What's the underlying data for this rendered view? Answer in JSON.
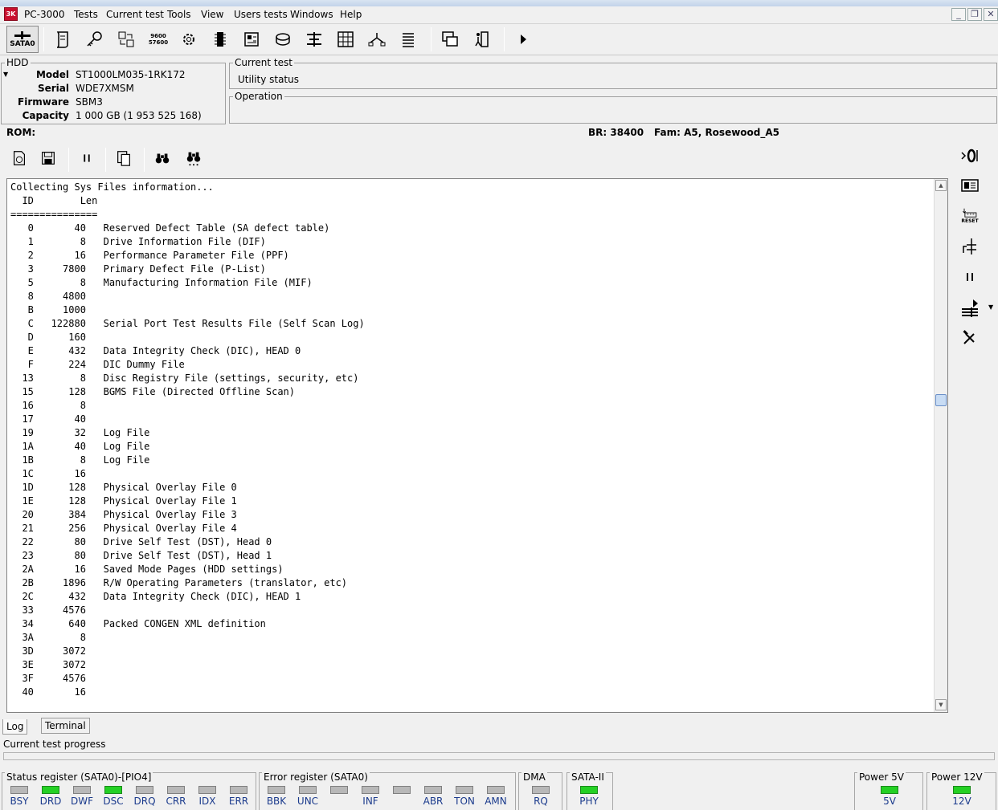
{
  "app": {
    "title": "PC-3000"
  },
  "menu": [
    "Tests",
    "Current test",
    "Tools",
    "View",
    "Users tests",
    "Windows",
    "Help"
  ],
  "toolbar": {
    "sata_label": "SATA0",
    "baud_top": "9600",
    "baud_bottom": "57600"
  },
  "hdd": {
    "legend": "HDD",
    "fields": [
      {
        "label": "Model",
        "value": "ST1000LM035-1RK172"
      },
      {
        "label": "Serial",
        "value": "WDE7XMSM"
      },
      {
        "label": "Firmware",
        "value": "SBM3"
      },
      {
        "label": "Capacity",
        "value": "1 000 GB (1 953 525 168)"
      }
    ]
  },
  "current_test": {
    "legend": "Current test",
    "value": "Utility status"
  },
  "operation": {
    "legend": "Operation"
  },
  "rom": {
    "label": "ROM:",
    "br": "BR: 38400",
    "fam": "Fam: A5, Rosewood_A5"
  },
  "log": {
    "header_line": "Collecting Sys Files information...",
    "col_id": "ID",
    "col_len": "Len",
    "rule": "===============",
    "rows": [
      [
        "0",
        "40",
        "Reserved Defect Table (SA defect table)"
      ],
      [
        "1",
        "8",
        "Drive Information File (DIF)"
      ],
      [
        "2",
        "16",
        "Performance Parameter File (PPF)"
      ],
      [
        "3",
        "7800",
        "Primary Defect File (P-List)"
      ],
      [
        "5",
        "8",
        "Manufacturing Information File (MIF)"
      ],
      [
        "8",
        "4800",
        ""
      ],
      [
        "B",
        "1000",
        ""
      ],
      [
        "C",
        "122880",
        "Serial Port Test Results File (Self Scan Log)"
      ],
      [
        "D",
        "160",
        ""
      ],
      [
        "E",
        "432",
        "Data Integrity Check (DIC), HEAD 0"
      ],
      [
        "F",
        "224",
        "DIC Dummy File"
      ],
      [
        "13",
        "8",
        "Disc Registry File (settings, security, etc)"
      ],
      [
        "15",
        "128",
        "BGMS File (Directed Offline Scan)"
      ],
      [
        "16",
        "8",
        ""
      ],
      [
        "17",
        "40",
        ""
      ],
      [
        "19",
        "32",
        "Log File"
      ],
      [
        "1A",
        "40",
        "Log File"
      ],
      [
        "1B",
        "8",
        "Log File"
      ],
      [
        "1C",
        "16",
        ""
      ],
      [
        "1D",
        "128",
        "Physical Overlay File 0"
      ],
      [
        "1E",
        "128",
        "Physical Overlay File 1"
      ],
      [
        "20",
        "384",
        "Physical Overlay File 3"
      ],
      [
        "21",
        "256",
        "Physical Overlay File 4"
      ],
      [
        "22",
        "80",
        "Drive Self Test (DST), Head 0"
      ],
      [
        "23",
        "80",
        "Drive Self Test (DST), Head 1"
      ],
      [
        "2A",
        "16",
        "Saved Mode Pages (HDD settings)"
      ],
      [
        "2B",
        "1896",
        "R/W Operating Parameters (translator, etc)"
      ],
      [
        "2C",
        "432",
        "Data Integrity Check (DIC), HEAD 1"
      ],
      [
        "33",
        "4576",
        ""
      ],
      [
        "34",
        "640",
        "Packed CONGEN XML definition"
      ],
      [
        "3A",
        "8",
        ""
      ],
      [
        "3D",
        "3072",
        ""
      ],
      [
        "3E",
        "3072",
        ""
      ],
      [
        "3F",
        "4576",
        ""
      ],
      [
        "40",
        "16",
        ""
      ]
    ]
  },
  "tabs": [
    "Log",
    "Terminal"
  ],
  "progress_label": "Current test progress",
  "status_register": {
    "legend": "Status register (SATA0)-[PIO4]",
    "leds": [
      {
        "label": "BSY",
        "on": false
      },
      {
        "label": "DRD",
        "on": true
      },
      {
        "label": "DWF",
        "on": false
      },
      {
        "label": "DSC",
        "on": true
      },
      {
        "label": "DRQ",
        "on": false
      },
      {
        "label": "CRR",
        "on": false
      },
      {
        "label": "IDX",
        "on": false
      },
      {
        "label": "ERR",
        "on": false
      }
    ]
  },
  "error_register": {
    "legend": "Error register (SATA0)",
    "leds": [
      {
        "label": "BBK",
        "on": false
      },
      {
        "label": "UNC",
        "on": false
      },
      {
        "label": "",
        "on": false
      },
      {
        "label": "INF",
        "on": false
      },
      {
        "label": "",
        "on": false
      },
      {
        "label": "ABR",
        "on": false
      },
      {
        "label": "TON",
        "on": false
      },
      {
        "label": "AMN",
        "on": false
      }
    ]
  },
  "dma": {
    "legend": "DMA",
    "leds": [
      {
        "label": "RQ",
        "on": false
      }
    ]
  },
  "sata2": {
    "legend": "SATA-II",
    "leds": [
      {
        "label": "PHY",
        "on": true
      }
    ]
  },
  "power5": {
    "legend": "Power 5V",
    "leds": [
      {
        "label": "5V",
        "on": true
      }
    ]
  },
  "power12": {
    "legend": "Power 12V",
    "leds": [
      {
        "label": "12V",
        "on": true
      }
    ]
  },
  "right_toolbar": {
    "reset_label": "RESET"
  },
  "colors": {
    "led_on": "#24d024",
    "led_off": "#b8b8b8",
    "led_label": "#1a3a8c"
  }
}
